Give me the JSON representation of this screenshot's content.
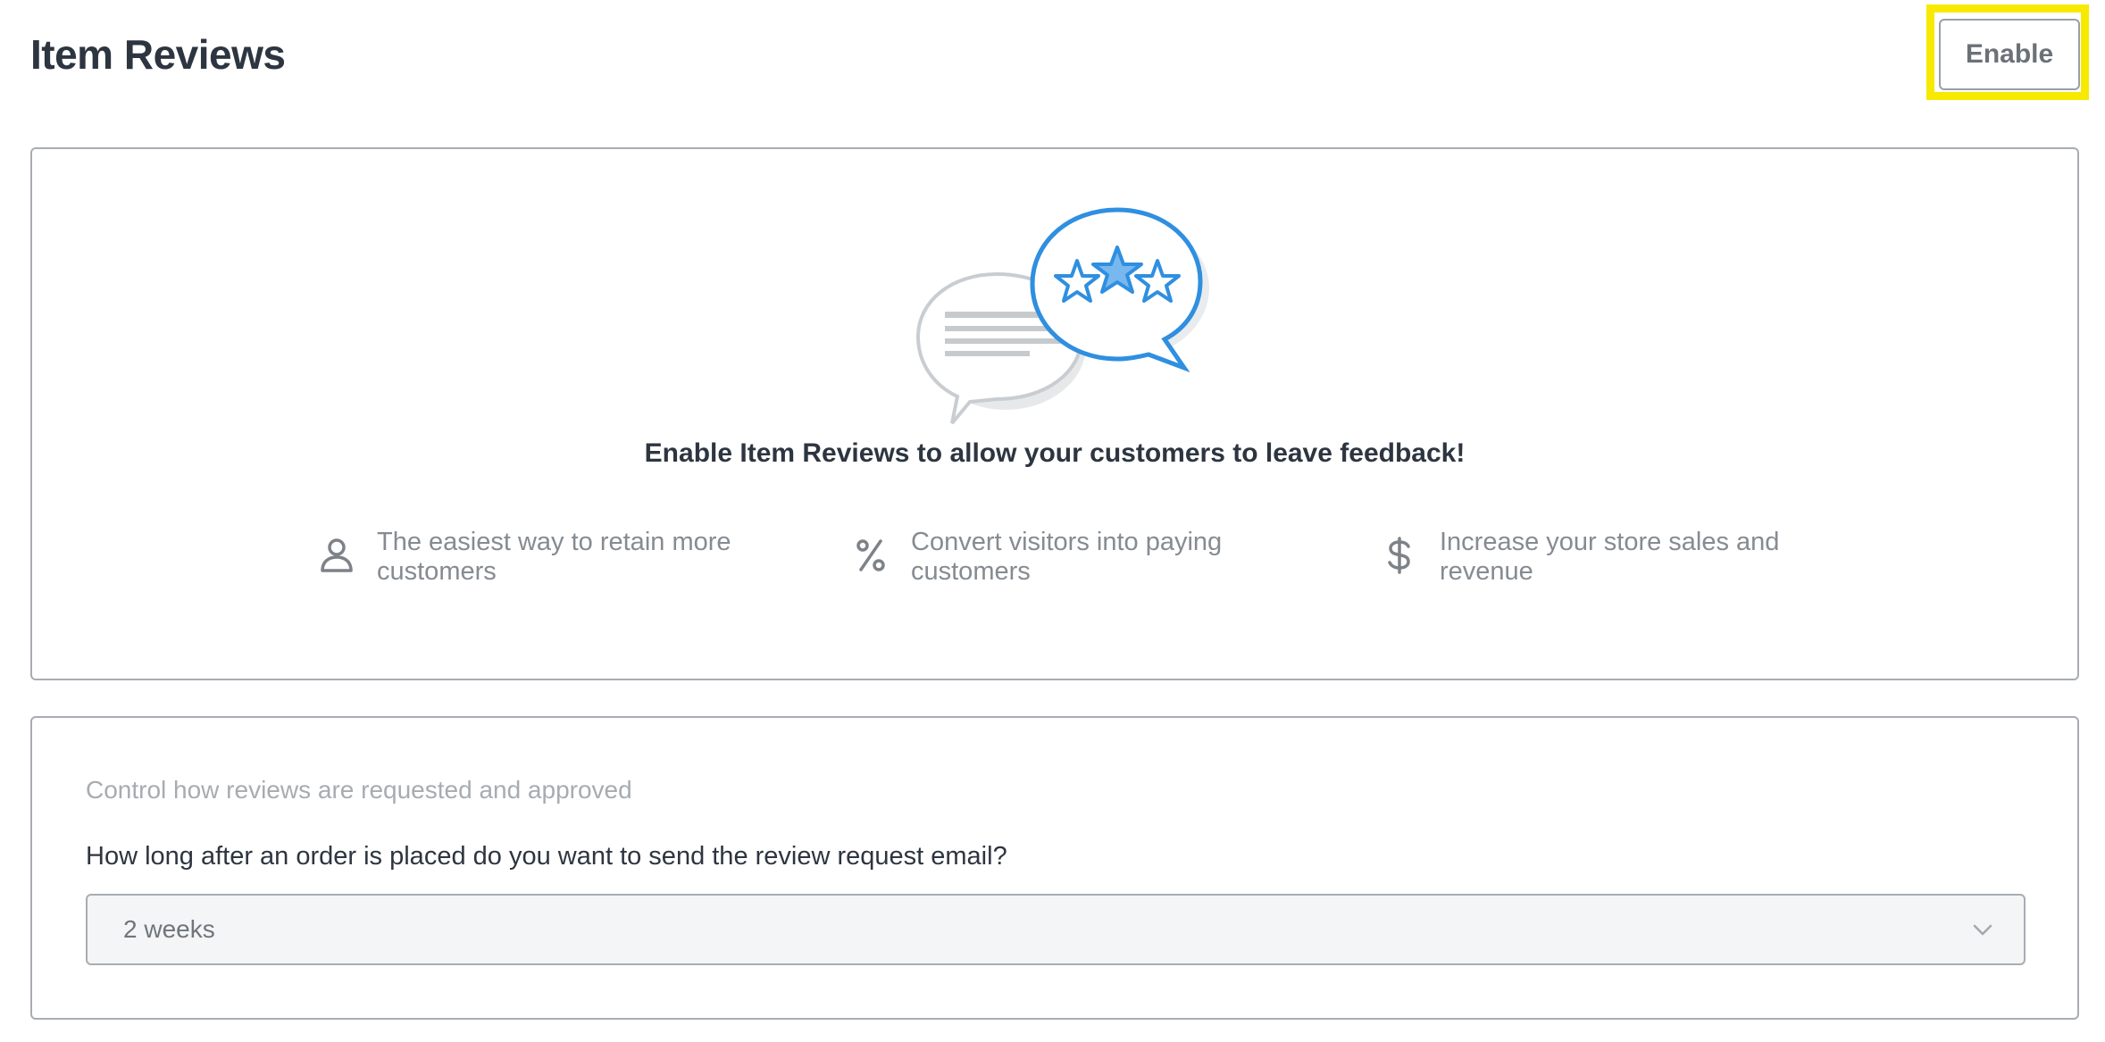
{
  "header": {
    "title": "Item Reviews",
    "enable_label": "Enable"
  },
  "intro": {
    "headline": "Enable Item Reviews to allow your customers to leave feedback!",
    "illustration_icon": "review-speech-bubbles-icon",
    "features": [
      {
        "icon": "person-icon",
        "text": "The easiest way to retain more customers"
      },
      {
        "icon": "percent-icon",
        "text": "Convert visitors into paying customers"
      },
      {
        "icon": "dollar-icon",
        "text": "Increase your store sales and revenue"
      }
    ]
  },
  "settings": {
    "subtitle": "Control how reviews are requested and approved",
    "question": "How long after an order is placed do you want to send the review request email?",
    "delay_select": {
      "selected": "2 weeks"
    }
  },
  "colors": {
    "accent_blue": "#2f8fe0",
    "star_fill": "#78b8ee",
    "highlight": "#f7ea00",
    "muted_text": "#858b91",
    "border": "#a8adb2"
  }
}
